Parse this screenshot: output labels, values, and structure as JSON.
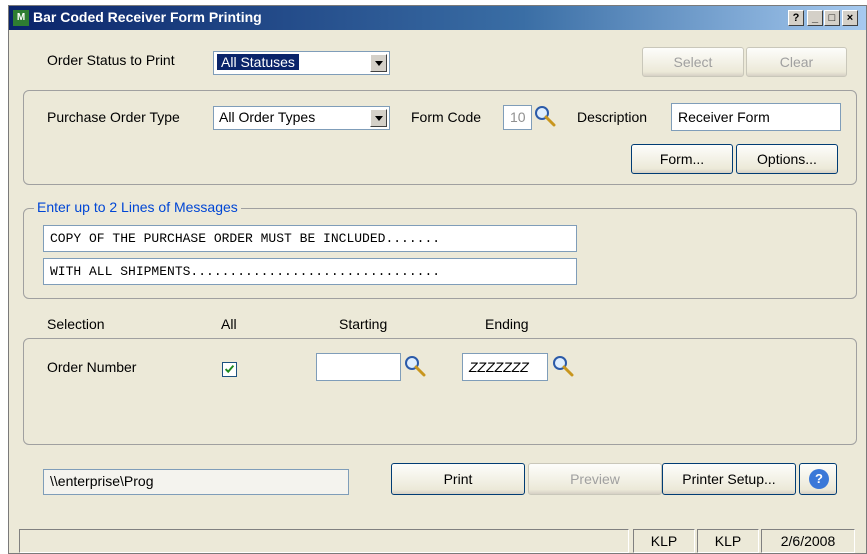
{
  "window": {
    "title": "Bar Coded Receiver Form Printing",
    "app_icon_text": "M",
    "controls": {
      "help": "?",
      "minimize": "_",
      "maximize": "□",
      "close": "×"
    }
  },
  "order_status": {
    "label": "Order Status to Print",
    "value": "All Statuses",
    "select_button": "Select",
    "clear_button": "Clear"
  },
  "form_options": {
    "po_type_label": "Purchase Order Type",
    "po_type_value": "All Order Types",
    "form_code_label": "Form Code",
    "form_code_value": "10",
    "description_label": "Description",
    "description_value": "Receiver Form",
    "form_button": "Form...",
    "options_button": "Options..."
  },
  "messages": {
    "legend": "Enter up to 2 Lines of Messages",
    "line1": "COPY OF THE PURCHASE ORDER MUST BE INCLUDED.......",
    "line2": "WITH ALL SHIPMENTS................................"
  },
  "selection": {
    "header_selection": "Selection",
    "header_all": "All",
    "header_starting": "Starting",
    "header_ending": "Ending",
    "row_label": "Order Number",
    "all_checked": true,
    "starting_value": "",
    "ending_value": "ZZZZZZZ"
  },
  "printer": {
    "path": "\\\\enterprise\\Prog",
    "print_button": "Print",
    "preview_button": "Preview",
    "printer_setup_button": "Printer Setup...",
    "help_button": "?"
  },
  "statusbar": {
    "company1": "KLP",
    "company2": "KLP",
    "date": "2/6/2008"
  },
  "colors": {
    "titlebar": "#0a246a",
    "legend": "#0046d5",
    "checkbox": "#1f8a1f",
    "face": "#ece9d8"
  }
}
